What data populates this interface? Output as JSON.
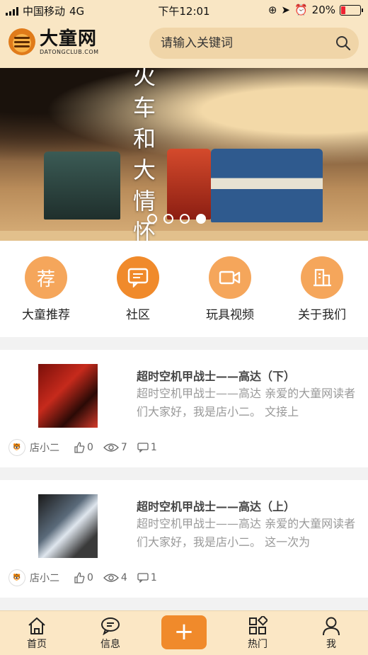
{
  "status_bar": {
    "carrier": "中国移动",
    "network": "4G",
    "time": "下午12:01",
    "battery": "20%"
  },
  "header": {
    "logo_title": "大童网",
    "logo_sub": "DATONGCLUB.COM",
    "search_placeholder": "请输入关键词"
  },
  "banner": {
    "text": "火车和大情怀",
    "dots": 4,
    "active_dot": 4
  },
  "categories": [
    {
      "label": "大童推荐",
      "glyph": "荐",
      "icon": "recommend-icon"
    },
    {
      "label": "社区",
      "glyph": "",
      "icon": "chat-icon"
    },
    {
      "label": "玩具视频",
      "glyph": "",
      "icon": "video-icon"
    },
    {
      "label": "关于我们",
      "glyph": "",
      "icon": "building-icon"
    }
  ],
  "posts": [
    {
      "title": "超时空机甲战士——高达（下）",
      "excerpt": "超时空机甲战士——高达 亲爱的大童网读者们大家好，我是店小二。 文接上",
      "author": "店小二",
      "likes": "0",
      "views": "7",
      "comments": "1"
    },
    {
      "title": "超时空机甲战士——高达（上）",
      "excerpt": "超时空机甲战士——高达 亲爱的大童网读者们大家好，我是店小二。 这一次为",
      "author": "店小二",
      "likes": "0",
      "views": "4",
      "comments": "1"
    }
  ],
  "tabbar": {
    "home": "首页",
    "messages": "信息",
    "add": "+",
    "hot": "热门",
    "me": "我"
  },
  "colors": {
    "accent": "#f08a2b",
    "header_bg": "#f9e6c4",
    "category_circle": "#f5a65b"
  }
}
